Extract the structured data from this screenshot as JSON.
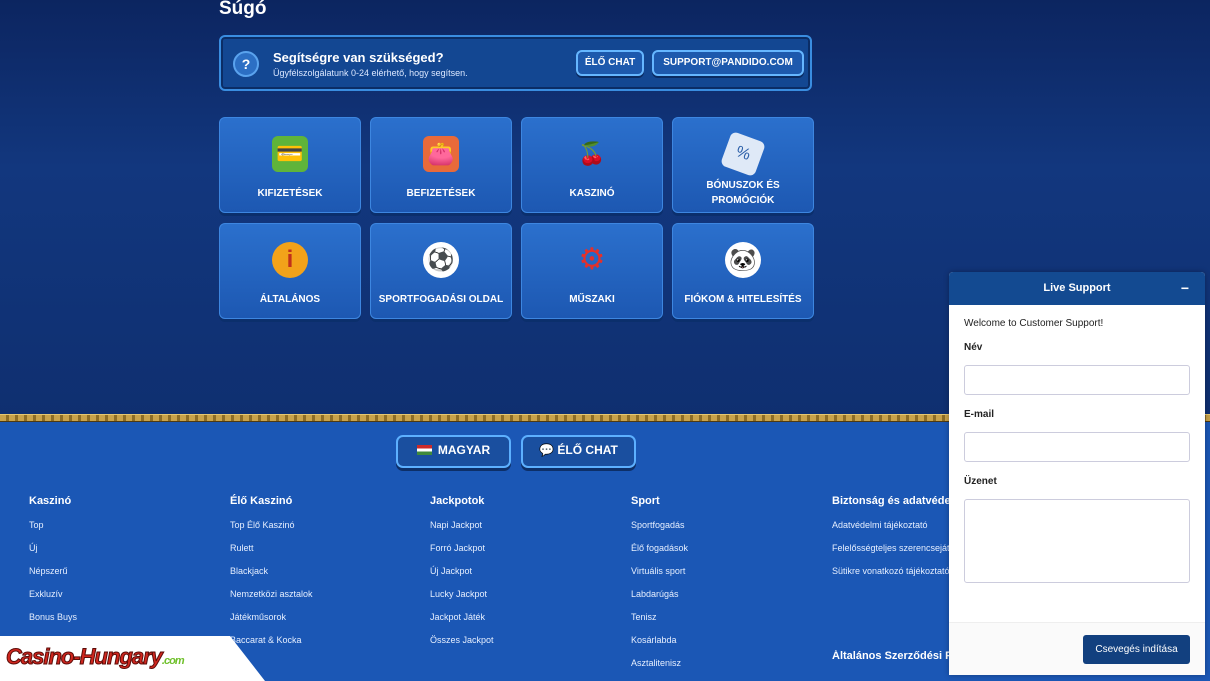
{
  "page": {
    "title": "Súgó"
  },
  "help": {
    "title": "Segítségre van szükséged?",
    "subtitle": "Ügyfélszolgálatunk 0-24 elérhető, hogy segítsen.",
    "chat_button": "ÉLŐ CHAT",
    "email_button": "SUPPORT@PANDIDO.COM"
  },
  "categories": [
    {
      "label": "KIFIZETÉSEK",
      "icon": "wallet-icon"
    },
    {
      "label": "BEFIZETÉSEK",
      "icon": "deposit-icon"
    },
    {
      "label": "KASZINÓ",
      "icon": "cherry-icon"
    },
    {
      "label": "BÓNUSZOK ÉS PROMÓCIÓK",
      "icon": "coupon-icon"
    },
    {
      "label": "ÁLTALÁNOS",
      "icon": "info-icon"
    },
    {
      "label": "SPORTFOGADÁSI OLDAL",
      "icon": "football-icon"
    },
    {
      "label": "MŰSZAKI",
      "icon": "gear-icon"
    },
    {
      "label": "FIÓKOM & HITELESÍTÉS",
      "icon": "panda-icon"
    }
  ],
  "footer": {
    "language_button": "MAGYAR",
    "chat_button": "ÉLŐ CHAT",
    "columns": [
      {
        "title": "Kaszinó",
        "links": [
          "Top",
          "Új",
          "Népszerű",
          "Exkluzív",
          "Bonus Buys"
        ]
      },
      {
        "title": "Élő Kaszinó",
        "links": [
          "Top Élő Kaszinó",
          "Rulett",
          "Blackjack",
          "Nemzetközi asztalok",
          "Játékműsorok",
          "Baccarat & Kocka"
        ]
      },
      {
        "title": "Jackpotok",
        "links": [
          "Napi Jackpot",
          "Forró Jackpot",
          "Új Jackpot",
          "Lucky Jackpot",
          "Jackpot Játék",
          "Összes Jackpot"
        ]
      },
      {
        "title": "Sport",
        "links": [
          "Sportfogadás",
          "Élő fogadások",
          "Virtuális sport",
          "Labdarúgás",
          "Tenisz",
          "Kosárlabda",
          "Asztalitenisz"
        ]
      },
      {
        "title": "Biztonság és adatvédelem",
        "links": [
          "Adatvédelmi tájékoztató",
          "Felelősségteljes szerencsejáték",
          "Sütikre vonatkozó tájékoztató"
        ]
      }
    ],
    "terms_heading": "Általános Szerződési Feltételek"
  },
  "logo": {
    "text": "Casino-Hungary",
    "suffix": ".com"
  },
  "chat": {
    "header": "Live Support",
    "minimize": "−",
    "welcome": "Welcome to Customer Support!",
    "name_label": "Név",
    "email_label": "E-mail",
    "message_label": "Üzenet",
    "start_button": "Csevegés indítása"
  }
}
